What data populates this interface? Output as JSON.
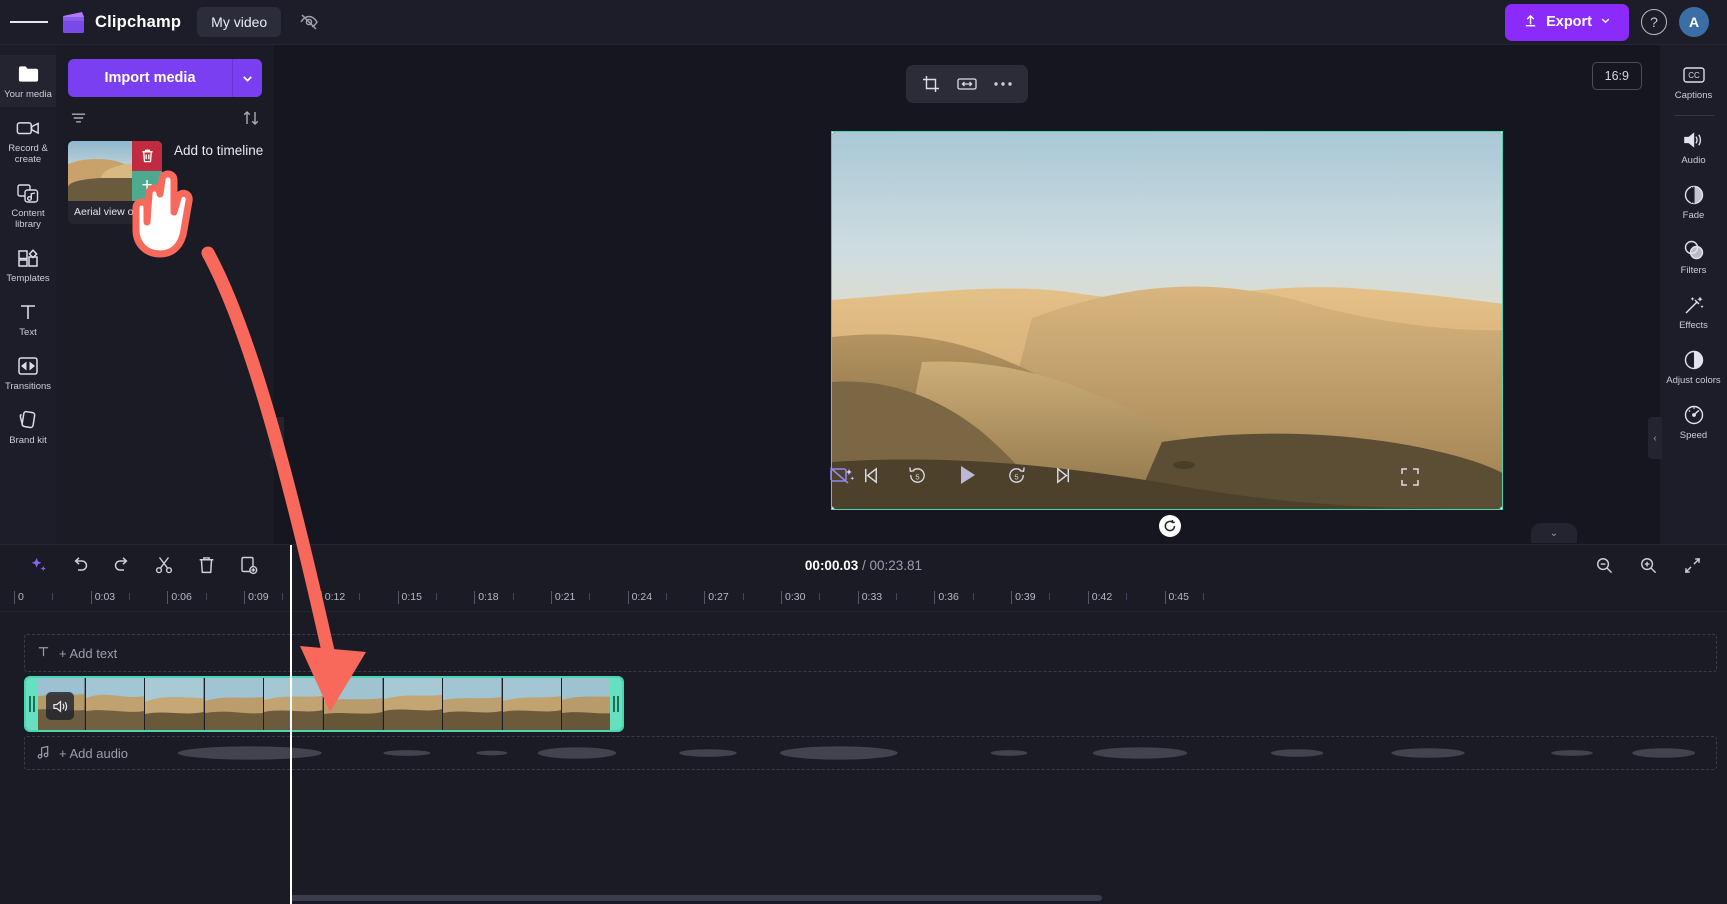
{
  "app": {
    "brand_name": "Clipchamp",
    "project_name": "My video",
    "menu_icon": "hamburger-icon",
    "hide_preview_icon": "eye-off-icon"
  },
  "topbar": {
    "export_label": "Export",
    "export_icon": "upload-icon",
    "export_caret": "chevron-down-icon",
    "help_icon": "question-circle-icon",
    "avatar_initial": "A",
    "export_color": "#8b2bfb"
  },
  "left_rail": {
    "items": [
      {
        "label": "Your media",
        "icon": "folder-icon",
        "active": true
      },
      {
        "label": "Record & create",
        "icon": "video-camera-icon",
        "active": false
      },
      {
        "label": "Content library",
        "icon": "media-library-icon",
        "active": false
      },
      {
        "label": "Templates",
        "icon": "templates-grid-icon",
        "active": false
      },
      {
        "label": "Text",
        "icon": "text-t-icon",
        "active": false
      },
      {
        "label": "Transitions",
        "icon": "transitions-icon",
        "active": false
      },
      {
        "label": "Brand kit",
        "icon": "brand-kit-icon",
        "active": false
      }
    ]
  },
  "media_panel": {
    "import_label": "Import media",
    "import_caret_icon": "chevron-down-icon",
    "filter_icon": "filter-icon",
    "sort_icon": "sort-arrows-icon",
    "collapse_icon": "chevron-left-icon",
    "item": {
      "name": "Aerial view of.",
      "delete_icon": "trash-icon",
      "add_icon": "plus-icon",
      "delete_color": "#c02b3f",
      "add_color": "#4caa8e"
    },
    "tooltip": "Add to timeline"
  },
  "preview": {
    "float_tools": [
      {
        "name": "crop-icon",
        "label": "Crop"
      },
      {
        "name": "fit-width-icon",
        "label": "Fit"
      },
      {
        "name": "more-options-icon",
        "label": "More"
      }
    ],
    "aspect_ratio": "16:9",
    "selection_color": "#4ad6b0",
    "rotate_icon": "rotate-icon",
    "background_remove_icon": "background-remove-icon",
    "fullscreen_icon": "fullscreen-icon",
    "controls": [
      {
        "name": "skip-to-start-button",
        "icon": "skip-back-icon"
      },
      {
        "name": "rewind-5-button",
        "icon": "rewind-5-icon"
      },
      {
        "name": "play-button",
        "icon": "play-icon"
      },
      {
        "name": "forward-5-button",
        "icon": "forward-5-icon"
      },
      {
        "name": "skip-to-end-button",
        "icon": "skip-forward-icon"
      }
    ]
  },
  "right_rail": {
    "items": [
      {
        "label": "Captions",
        "icon": "captions-cc-icon"
      },
      {
        "label": "Audio",
        "icon": "speaker-icon"
      },
      {
        "label": "Fade",
        "icon": "fade-circle-icon"
      },
      {
        "label": "Filters",
        "icon": "filters-circles-icon"
      },
      {
        "label": "Effects",
        "icon": "magic-wand-icon"
      },
      {
        "label": "Adjust colors",
        "icon": "contrast-circle-icon"
      },
      {
        "label": "Speed",
        "icon": "speedometer-icon"
      }
    ],
    "collapse_icon": "chevron-right-icon"
  },
  "timeline": {
    "toolbar": [
      {
        "name": "ai-magic-button",
        "icon": "sparkle-icon"
      },
      {
        "name": "undo-button",
        "icon": "undo-icon"
      },
      {
        "name": "redo-button",
        "icon": "redo-icon"
      },
      {
        "name": "split-button",
        "icon": "scissors-icon"
      },
      {
        "name": "delete-button",
        "icon": "trash-icon"
      },
      {
        "name": "duplicate-button",
        "icon": "duplicate-icon"
      }
    ],
    "current_time": "00:00.03",
    "time_separator": "/",
    "total_time": "00:23.81",
    "zoom_controls": [
      {
        "name": "zoom-out-button",
        "icon": "magnifier-minus-icon"
      },
      {
        "name": "zoom-in-button",
        "icon": "magnifier-plus-icon"
      },
      {
        "name": "fit-timeline-button",
        "icon": "fit-arrows-icon"
      }
    ],
    "ruler_labels": [
      "0",
      "0:03",
      "0:06",
      "0:09",
      "0:12",
      "0:15",
      "0:18",
      "0:21",
      "0:24",
      "0:27",
      "0:30",
      "0:33",
      "0:36",
      "0:39",
      "0:42",
      "0:45"
    ],
    "add_text_label": "+ Add text",
    "add_text_icon": "text-t-icon",
    "add_audio_label": "+ Add audio",
    "add_audio_icon": "music-note-icon",
    "clip": {
      "speaker_icon": "speaker-icon",
      "left_handle": "trim-left-handle",
      "right_handle": "trim-right-handle",
      "border_color": "#4ad6b0"
    },
    "expand_icon": "chevron-down-icon"
  },
  "annotation": {
    "cursor_icon": "pointing-hand-cursor",
    "arrow_icon": "curved-arrow",
    "arrow_color": "#f9695b"
  }
}
